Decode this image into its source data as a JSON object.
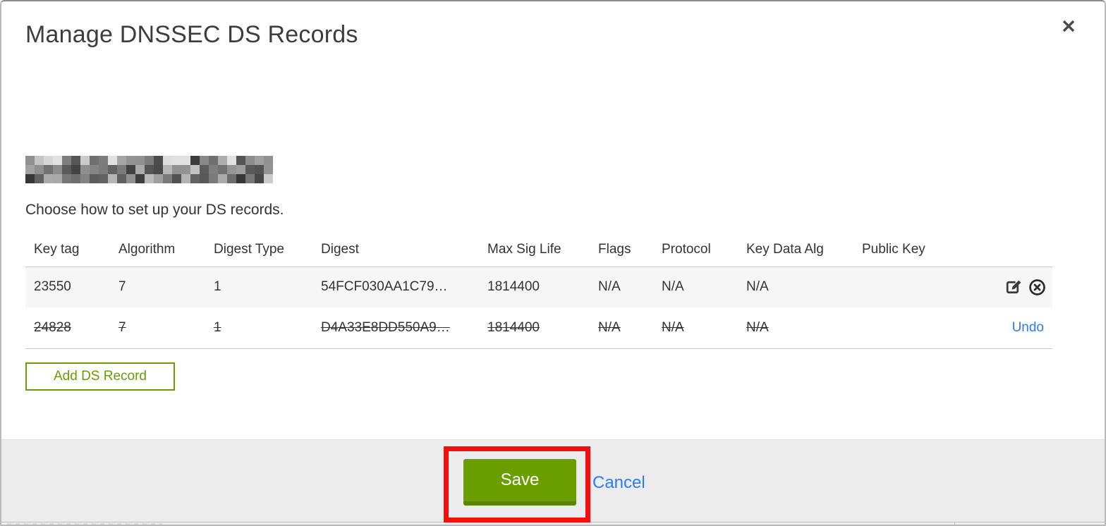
{
  "modal": {
    "title": "Manage DNSSEC DS Records",
    "subtitle": "Choose how to set up your DS records.",
    "domain_redacted": true
  },
  "table": {
    "headers": [
      "Key tag",
      "Algorithm",
      "Digest Type",
      "Digest",
      "Max Sig Life",
      "Flags",
      "Protocol",
      "Key Data Alg",
      "Public Key"
    ],
    "rows": [
      {
        "key_tag": "23550",
        "algorithm": "7",
        "digest_type": "1",
        "digest": "54FCF030AA1C79…",
        "max_sig_life": "1814400",
        "flags": "N/A",
        "protocol": "N/A",
        "key_data_alg": "N/A",
        "public_key": "",
        "deleted": false,
        "actions": [
          "edit",
          "delete"
        ]
      },
      {
        "key_tag": "24828",
        "algorithm": "7",
        "digest_type": "1",
        "digest": "D4A33E8DD550A9…",
        "max_sig_life": "1814400",
        "flags": "N/A",
        "protocol": "N/A",
        "key_data_alg": "N/A",
        "public_key": "",
        "deleted": true,
        "undo_label": "Undo"
      }
    ]
  },
  "buttons": {
    "add_ds_record": "Add DS Record",
    "save": "Save",
    "cancel": "Cancel"
  },
  "colors": {
    "accent_green": "#6b9c00",
    "save_green": "#6b9e00",
    "link_blue": "#2d7bf5",
    "annotation_red": "#f70d0d",
    "footer_gray": "#ececec"
  }
}
